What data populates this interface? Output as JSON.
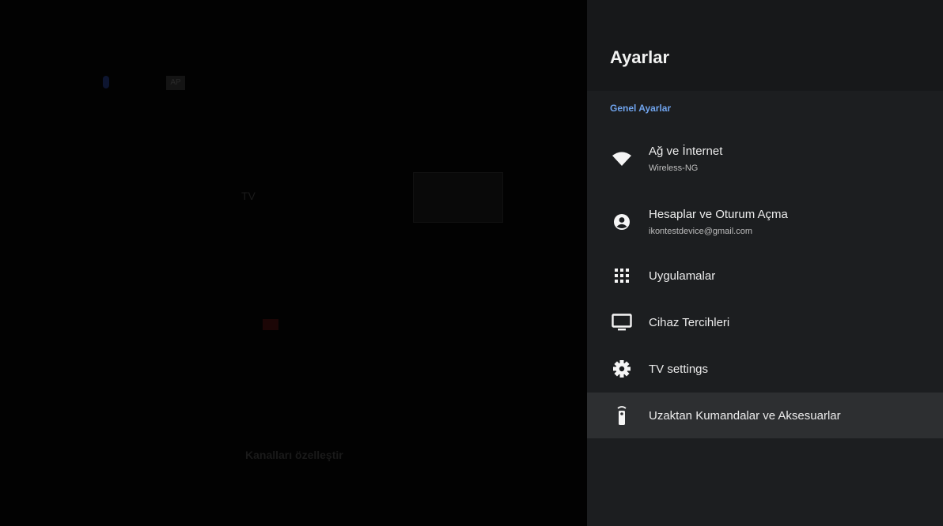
{
  "background": {
    "ap_badge": "AP",
    "tv_label": "TV",
    "customize_channels": "Kanalları özelleştir"
  },
  "settings": {
    "title": "Ayarlar",
    "section": "Genel Ayarlar",
    "items": [
      {
        "label": "Ağ ve İnternet",
        "sub": "Wireless-NG",
        "icon": "wifi-icon"
      },
      {
        "label": "Hesaplar ve Oturum Açma",
        "sub": "ikontestdevice@gmail.com",
        "icon": "account-icon"
      },
      {
        "label": "Uygulamalar",
        "icon": "apps-grid-icon"
      },
      {
        "label": "Cihaz Tercihleri",
        "icon": "tv-icon"
      },
      {
        "label": "TV settings",
        "icon": "gear-icon"
      },
      {
        "label": "Uzaktan Kumandalar ve Aksesuarlar",
        "icon": "remote-icon"
      }
    ],
    "selected_index": 5
  },
  "colors": {
    "panel_bg": "#1c1e20",
    "header_bg": "#17181a",
    "accent": "#6fa3ec",
    "selected_bg": "#2d2f31"
  }
}
